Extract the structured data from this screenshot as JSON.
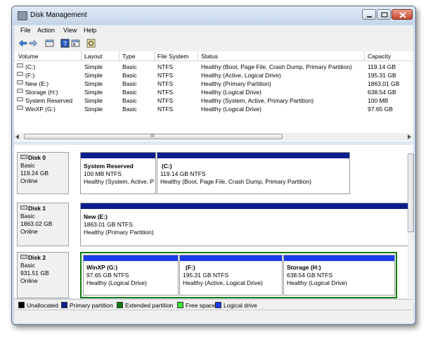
{
  "window": {
    "title": "Disk Management"
  },
  "menu": [
    "File",
    "Action",
    "View",
    "Help"
  ],
  "toolbar": {
    "icons": [
      "back-arrow-icon",
      "forward-arrow-icon",
      "properties-icon",
      "help-icon",
      "console-icon",
      "settings-icon"
    ]
  },
  "volume_list": {
    "columns": [
      "Volume",
      "Layout",
      "Type",
      "File System",
      "Status",
      "Capacity"
    ],
    "rows": [
      {
        "volume": "(C:)",
        "layout": "Simple",
        "type": "Basic",
        "fs": "NTFS",
        "status": "Healthy (Boot, Page File, Crash Dump, Primary Partition)",
        "capacity": "119.14 GB"
      },
      {
        "volume": "(F:)",
        "layout": "Simple",
        "type": "Basic",
        "fs": "NTFS",
        "status": "Healthy (Active, Logical Drive)",
        "capacity": "195.31 GB"
      },
      {
        "volume": "New (E:)",
        "layout": "Simple",
        "type": "Basic",
        "fs": "NTFS",
        "status": "Healthy (Primary Partition)",
        "capacity": "1863.01 GB"
      },
      {
        "volume": "Storage (H:)",
        "layout": "Simple",
        "type": "Basic",
        "fs": "NTFS",
        "status": "Healthy (Logical Drive)",
        "capacity": "638.54 GB"
      },
      {
        "volume": "System Reserved",
        "layout": "Simple",
        "type": "Basic",
        "fs": "NTFS",
        "status": "Healthy (System, Active, Primary Partition)",
        "capacity": "100 MB"
      },
      {
        "volume": "WinXP (G:)",
        "layout": "Simple",
        "type": "Basic",
        "fs": "NTFS",
        "status": "Healthy (Logical Drive)",
        "capacity": "97.65 GB"
      }
    ],
    "scroll_grip": "III"
  },
  "disks": [
    {
      "name": "Disk 0",
      "type": "Basic",
      "size": "119.24 GB",
      "state": "Online",
      "partitions": [
        {
          "name": "System Reserved",
          "size": "100 MB NTFS",
          "status": "Healthy (System, Active, P"
        },
        {
          "name": "(C:)",
          "size": "119.14 GB NTFS",
          "status": "Healthy (Boot, Page File, Crash Dump, Primary Partition)"
        }
      ]
    },
    {
      "name": "Disk 1",
      "type": "Basic",
      "size": "1863.02 GB",
      "state": "Online",
      "partitions": [
        {
          "name": "New  (E:)",
          "size": "1863.01 GB NTFS",
          "status": "Healthy (Primary Partition)"
        }
      ]
    },
    {
      "name": "Disk 2",
      "type": "Basic",
      "size": "931.51 GB",
      "state": "Online",
      "partitions": [
        {
          "name": "WinXP  (G:)",
          "size": "97.65 GB NTFS",
          "status": "Healthy (Logical Drive)"
        },
        {
          "name": "(F:)",
          "size": "195.31 GB NTFS",
          "status": "Healthy (Active, Logical Drive)"
        },
        {
          "name": "Storage  (H:)",
          "size": "638.54 GB NTFS",
          "status": "Healthy (Logical Drive)"
        }
      ]
    }
  ],
  "legend": [
    {
      "label": "Unallocated",
      "color": "#000000"
    },
    {
      "label": "Primary partition",
      "color": "#0a1f8c"
    },
    {
      "label": "Extended partition",
      "color": "#0f7a0f"
    },
    {
      "label": "Free space",
      "color": "#39e639"
    },
    {
      "label": "Logical drive",
      "color": "#1a3df0"
    }
  ]
}
